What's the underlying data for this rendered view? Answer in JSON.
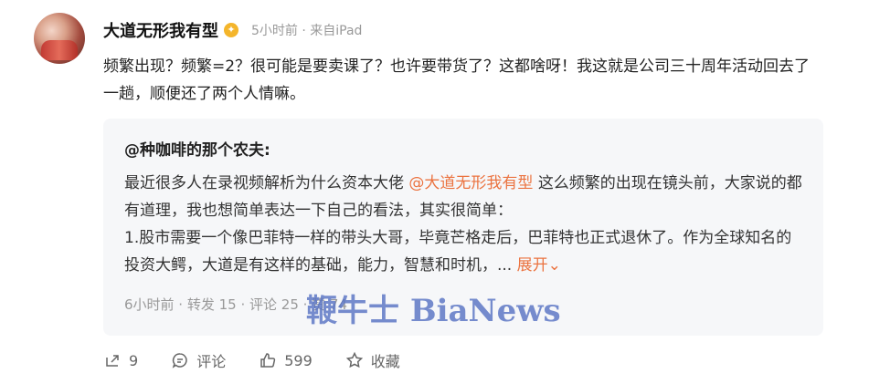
{
  "post": {
    "username": "大道无形我有型",
    "meta": "5小时前 · 来自iPad",
    "text": "频繁出现？频繁=2？很可能是要卖课了？也许要带货了？这都啥呀！我这就是公司三十周年活动回去了一趟，顺便还了两个人情嘛。"
  },
  "repost": {
    "author": "@种咖啡的那个农夫:",
    "text_before": "最近很多人在录视频解析为什么资本大佬",
    "mention": "@大道无形我有型",
    "text_after": "这么频繁的出现在镜头前，大家说的都有道理，我也想简单表达一下自己的看法，其实很简单：",
    "text_point1": "1.股市需要一个像巴菲特一样的带头大哥，毕竟芒格走后，巴菲特也正式退休了。作为全球知名的投资大鳄，大道是有这样的基础，能力，智慧和时机，...",
    "expand_label": "展开",
    "meta": "6小时前 · 转发 15 · 评论 25 · 赞 74"
  },
  "watermark": "鞭牛士 BiaNews",
  "actions": {
    "share_count": "9",
    "comment_label": "评论",
    "like_count": "599",
    "favorite_label": "收藏"
  },
  "colors": {
    "accent": "#eb7340",
    "muted": "#999999",
    "card_bg": "#f6f7f9"
  }
}
